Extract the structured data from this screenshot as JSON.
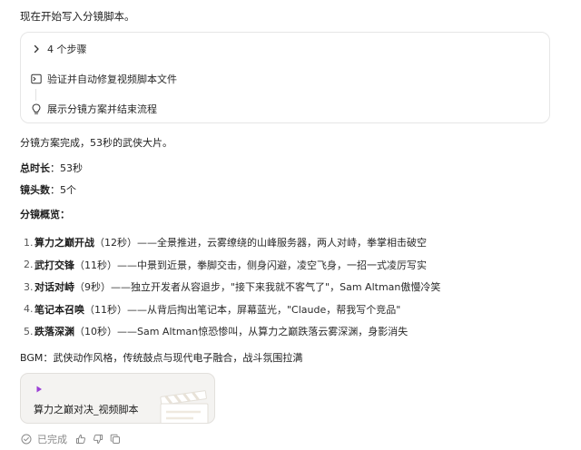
{
  "intro_text": "现在开始写入分镜脚本。",
  "steps": [
    {
      "label": "4 个步骤",
      "icon": "chevron-right-icon"
    },
    {
      "label": "验证并自动修复视频脚本文件",
      "icon": "terminal-icon"
    },
    {
      "label": "展示分镜方案并结束流程",
      "icon": "lightbulb-icon"
    }
  ],
  "summary": "分镜方案完成，53秒的武侠大片。",
  "duration": {
    "label": "总时长",
    "sep": "：",
    "value": "53秒"
  },
  "shots_count": {
    "label": "镜头数",
    "sep": "：",
    "value": "5个"
  },
  "overview_heading": "分镜概览：",
  "shots": [
    {
      "num": "1.",
      "title": "算力之巅开战",
      "rest": "（12秒）——全景推进，云雾缭绕的山峰服务器，两人对峙，拳掌相击破空"
    },
    {
      "num": "2.",
      "title": "武打交锋",
      "rest": "（11秒）——中景到近景，拳脚交击，侧身闪避，凌空飞身，一招一式凌厉写实"
    },
    {
      "num": "3.",
      "title": "对话对峙",
      "rest": "（9秒）——独立开发者从容退步，\"接下来我就不客气了\"，Sam Altman傲慢冷笑"
    },
    {
      "num": "4.",
      "title": "笔记本召唤",
      "rest": "（11秒）——从背后掏出笔记本，屏幕蓝光，\"Claude，帮我写个竞品\""
    },
    {
      "num": "5.",
      "title": "跌落深渊",
      "rest": "（10秒）——Sam Altman惊恐惨叫，从算力之巅跌落云雾深渊，身影消失"
    }
  ],
  "bgm_text": "BGM：武侠动作风格，传统鼓点与现代电子融合，战斗氛围拉满",
  "file_card": {
    "name": "算力之巅对决_视频脚本",
    "icon": "play-icon",
    "thumb": "clapperboard-icon"
  },
  "footer": {
    "status": "已完成",
    "status_icon": "check-circle-icon",
    "actions": [
      "thumbs-up-icon",
      "thumbs-down-icon",
      "copy-icon"
    ]
  },
  "colors": {
    "accent": "#9b3fd6",
    "text": "#1f1f1f",
    "muted": "#8a8a8a",
    "card_bg": "#f4f3f1"
  }
}
